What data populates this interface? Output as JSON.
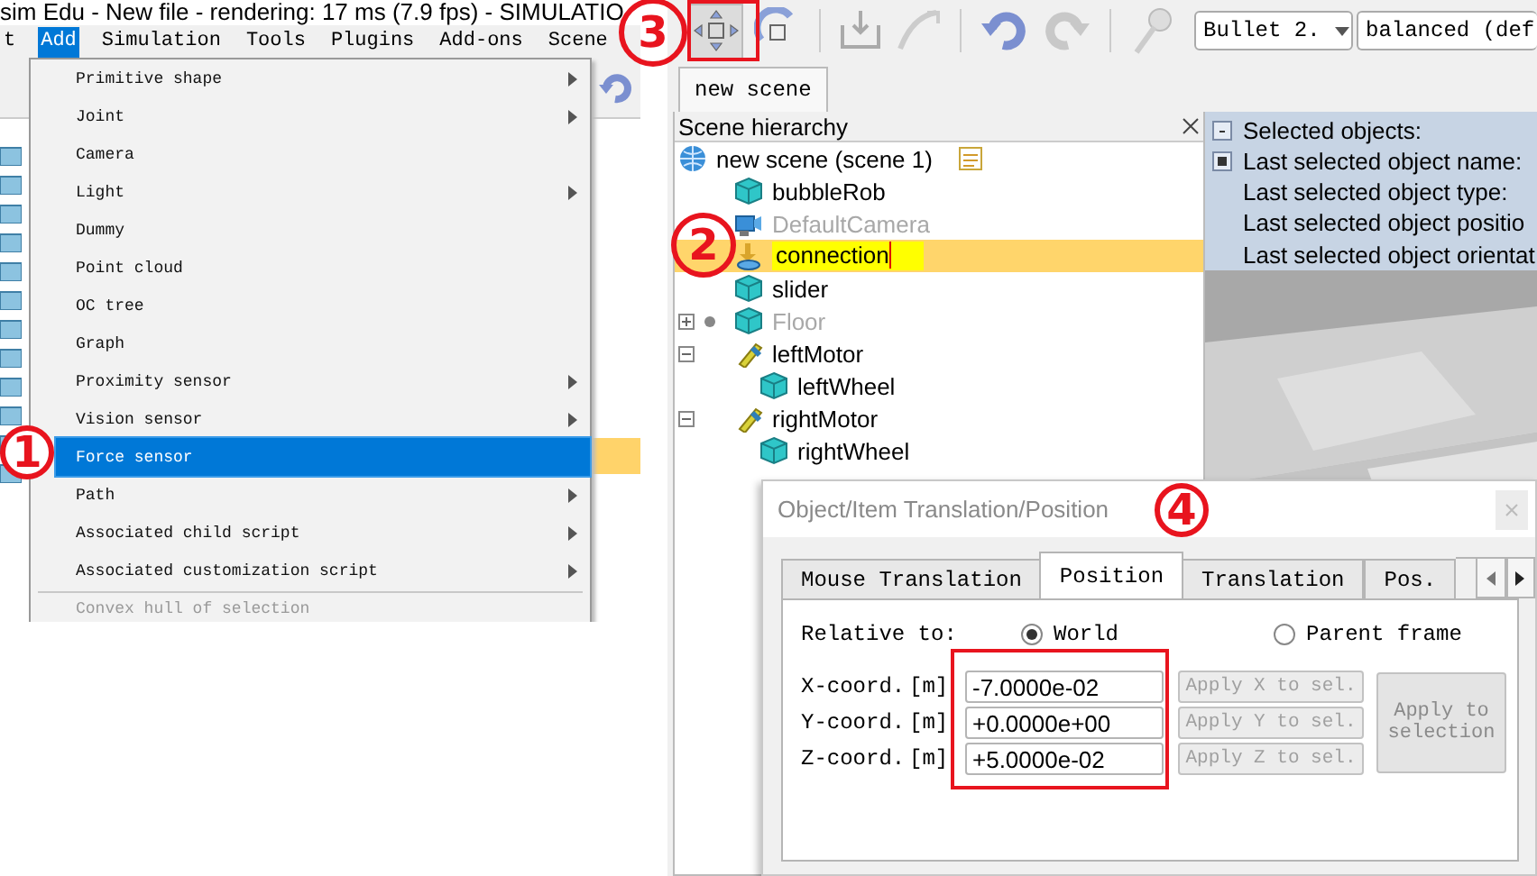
{
  "left_window": {
    "title": "sim Edu - New file - rendering: 17 ms (7.9 fps) - SIMULATIO",
    "menu_bar": [
      {
        "label": "t",
        "selected": false
      },
      {
        "label": "Add",
        "selected": true
      },
      {
        "label": "Simulation",
        "selected": false
      },
      {
        "label": "Tools",
        "selected": false
      },
      {
        "label": "Plugins",
        "selected": false
      },
      {
        "label": "Add-ons",
        "selected": false
      },
      {
        "label": "Scene",
        "selected": false
      }
    ],
    "add_menu": [
      {
        "label": "Primitive shape",
        "submenu": true,
        "selected": false,
        "disabled": false
      },
      {
        "label": "Joint",
        "submenu": true,
        "selected": false,
        "disabled": false
      },
      {
        "label": "Camera",
        "submenu": false,
        "selected": false,
        "disabled": false
      },
      {
        "label": "Light",
        "submenu": true,
        "selected": false,
        "disabled": false
      },
      {
        "label": "Dummy",
        "submenu": false,
        "selected": false,
        "disabled": false
      },
      {
        "label": "Point cloud",
        "submenu": false,
        "selected": false,
        "disabled": false
      },
      {
        "label": "OC tree",
        "submenu": false,
        "selected": false,
        "disabled": false
      },
      {
        "label": "Graph",
        "submenu": false,
        "selected": false,
        "disabled": false
      },
      {
        "label": "Proximity sensor",
        "submenu": true,
        "selected": false,
        "disabled": false
      },
      {
        "label": "Vision sensor",
        "submenu": true,
        "selected": false,
        "disabled": false
      },
      {
        "label": "Force sensor",
        "submenu": false,
        "selected": true,
        "disabled": false
      },
      {
        "label": "Path",
        "submenu": true,
        "selected": false,
        "disabled": false
      },
      {
        "label": "Associated child script",
        "submenu": true,
        "selected": false,
        "disabled": false
      },
      {
        "label": "Associated customization script",
        "submenu": true,
        "selected": false,
        "disabled": false
      },
      {
        "label": "Convex hull of selection",
        "submenu": false,
        "selected": false,
        "disabled": true,
        "separator_before": true
      }
    ]
  },
  "right_window": {
    "toolbar": {
      "engine": "Bullet 2.",
      "mode": "balanced (def"
    },
    "tabs": [
      {
        "label": "new scene",
        "selected": true
      }
    ],
    "hierarchy": {
      "title": "Scene hierarchy",
      "root": {
        "label": "new scene (scene 1)",
        "kind": "scene",
        "selected": false,
        "dimmed": false,
        "children": [
          {
            "label": "bubbleRob",
            "kind": "shape",
            "selected": false,
            "dimmed": false
          },
          {
            "label": "DefaultCamera",
            "kind": "camera",
            "selected": false,
            "dimmed": true
          },
          {
            "label": "connection",
            "kind": "force_sensor",
            "selected": true,
            "dimmed": false,
            "editing": true
          },
          {
            "label": "slider",
            "kind": "shape",
            "selected": false,
            "dimmed": false
          },
          {
            "label": "Floor",
            "kind": "shape",
            "selected": false,
            "dimmed": true,
            "expanded": false,
            "model": true
          },
          {
            "label": "leftMotor",
            "kind": "joint",
            "selected": false,
            "dimmed": false,
            "expanded": true,
            "children": [
              {
                "label": "leftWheel",
                "kind": "shape",
                "selected": false,
                "dimmed": false
              }
            ]
          },
          {
            "label": "rightMotor",
            "kind": "joint",
            "selected": false,
            "dimmed": false,
            "expanded": true,
            "children": [
              {
                "label": "rightWheel",
                "kind": "shape",
                "selected": false,
                "dimmed": false
              }
            ]
          }
        ]
      }
    },
    "info": [
      "Selected objects:",
      "Last selected object name:",
      "Last selected object type:",
      "Last selected object positio",
      "Last selected object orientat"
    ]
  },
  "dialog": {
    "title": "Object/Item Translation/Position",
    "tabs": [
      {
        "label": "Mouse Translation",
        "selected": false
      },
      {
        "label": "Position",
        "selected": true
      },
      {
        "label": "Translation",
        "selected": false
      },
      {
        "label": "Pos.",
        "selected": false
      }
    ],
    "relative_to": {
      "label": "Relative to:",
      "options": [
        {
          "label": "World",
          "selected": true
        },
        {
          "label": "Parent frame",
          "selected": false
        }
      ]
    },
    "coords": [
      {
        "label": "X-coord.",
        "unit": "[m]",
        "value": "-7.0000e-02",
        "button": "Apply X to sel.",
        "button_disabled": true
      },
      {
        "label": "Y-coord.",
        "unit": "[m]",
        "value": "+0.0000e+00",
        "button": "Apply Y to sel.",
        "button_disabled": true
      },
      {
        "label": "Z-coord.",
        "unit": "[m]",
        "value": "+5.0000e-02",
        "button": "Apply Z to sel.",
        "button_disabled": true
      }
    ],
    "apply_button": {
      "label": "Apply to selection",
      "disabled": true
    }
  },
  "annotations": [
    {
      "label": "1"
    },
    {
      "label": "2"
    },
    {
      "label": "3"
    },
    {
      "label": "4"
    }
  ]
}
